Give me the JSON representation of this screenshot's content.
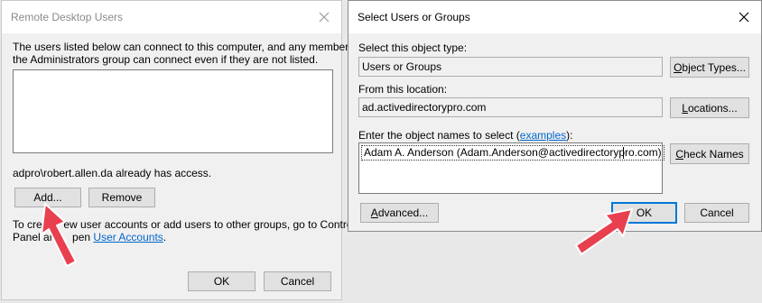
{
  "left_dialog": {
    "title": "Remote Desktop Users",
    "intro_line1": "The users listed below can connect to this computer, and any members of",
    "intro_line2": "the Administrators group can connect even if they are not listed.",
    "users": [],
    "access_status": "adpro\\robert.allen.da already has access.",
    "add_label": "Add...",
    "remove_label": "Remove",
    "footer_line1_a": "To crea",
    "footer_line1_b": "ew user accounts or add users to other groups, go to Control",
    "footer_line2_a": "Panel and",
    "footer_line2_b": "pen",
    "footer_link": "User Accounts",
    "footer_end": ".",
    "ok_label": "OK",
    "cancel_label": "Cancel"
  },
  "right_dialog": {
    "title": "Select Users or Groups",
    "object_type_label": "Select this object type:",
    "object_type_value": "Users or Groups",
    "object_types_button": "Object Types...",
    "location_label": "From this location:",
    "location_value": "ad.activedirectorypro.com",
    "locations_button": "Locations...",
    "names_label_prefix": "Enter the object names to select (",
    "names_label_link": "examples",
    "names_label_suffix": "):",
    "names_value": "Adam A. Anderson (Adam.Anderson@activedirectorypro.com)",
    "check_names_button": "Check Names",
    "advanced_button": "Advanced...",
    "ok_label": "OK",
    "cancel_label": "Cancel"
  },
  "annotations": {
    "arrow_color": "#e8404f"
  },
  "icons": [
    "close-icon",
    "close-icon",
    "red-arrow-annotation",
    "red-arrow-annotation"
  ]
}
